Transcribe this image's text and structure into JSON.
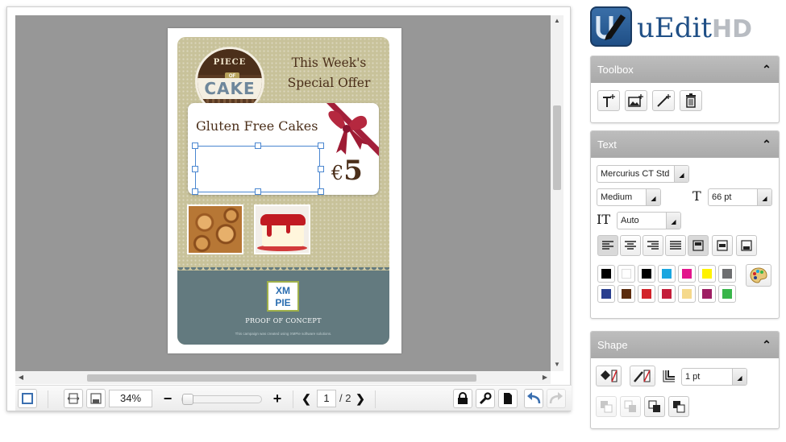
{
  "poster": {
    "logo_top": "PIECE",
    "logo_of": "OF",
    "logo_main": "CAKE",
    "offer_line1": "This Week's",
    "offer_line2": "Special Offer",
    "product_name": "Gluten Free Cakes",
    "price_currency": "€",
    "price_value": "5",
    "sponsor_logo_line1": "XM",
    "sponsor_logo_line2": "PIE",
    "proof_text": "PROOF OF CONCEPT",
    "small_print": "This campaign was created using XMPie software solutions."
  },
  "toolbar": {
    "zoom_value": "34%",
    "zoom_minus": "−",
    "zoom_plus": "+",
    "page_current": "1",
    "page_total": "/ 2",
    "page_prev": "❮",
    "page_next": "❯"
  },
  "brand": {
    "name": "uEdit",
    "suffix": "HD"
  },
  "panels": {
    "toolbox": {
      "title": "Toolbox",
      "toggle": "⌃"
    },
    "text": {
      "title": "Text",
      "toggle": "⌃",
      "font_family": "Mercurius CT Std",
      "font_weight": "Medium",
      "font_size": "66 pt",
      "leading": "Auto",
      "size_icon": "T",
      "leading_icon": "IT"
    },
    "shape": {
      "title": "Shape",
      "toggle": "⌃",
      "stroke_width": "1 pt"
    }
  },
  "colors": {
    "swatches_row1": [
      "#000000",
      "#ffffff",
      "#000000",
      "#1aa6e0",
      "#e3168c",
      "#fff200",
      "#6d6e70"
    ],
    "swatches_row2": [
      "#2a3f8f",
      "#5b2c0d",
      "#d2232a",
      "#c41e3a",
      "#f5d98b",
      "#9e1f63",
      "#39b54a"
    ]
  },
  "icons": {
    "fit_page": "fit-page-icon",
    "fit_width": "fit-width-icon",
    "lock": "lock-icon",
    "wrench": "wrench-icon",
    "document": "document-icon",
    "undo": "undo-icon",
    "redo": "redo-icon"
  }
}
